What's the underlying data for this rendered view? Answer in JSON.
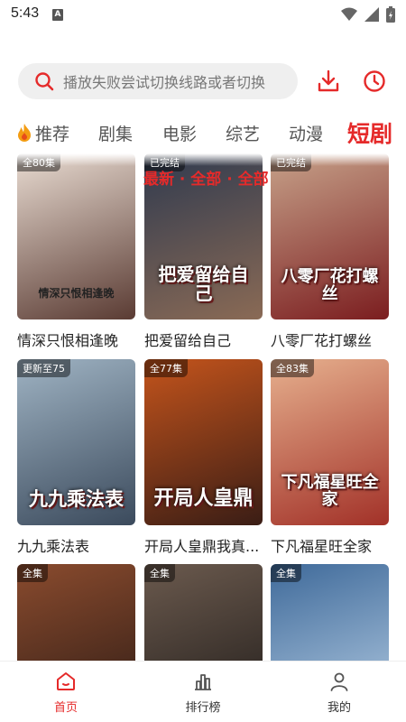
{
  "status_bar": {
    "time": "5:43",
    "notification_letter": "A"
  },
  "search": {
    "placeholder": "播放失败尝试切换线路或者切换"
  },
  "tabs": [
    {
      "label": "推荐"
    },
    {
      "label": "剧集"
    },
    {
      "label": "电影"
    },
    {
      "label": "综艺"
    },
    {
      "label": "动漫"
    },
    {
      "label": "短剧",
      "active": true
    }
  ],
  "filter_label": "最新 · 全部 · 全部",
  "cards": [
    {
      "badge": "全80集",
      "title": "情深只恨相逢晚",
      "poster_text": "情深只恨相逢晚",
      "colors": [
        "#e9dcd2",
        "#5a3b33"
      ]
    },
    {
      "badge": "已完结",
      "title": "把爱留给自己",
      "poster_text": "把爱留给自己",
      "colors": [
        "#2f3a4f",
        "#8a6a55"
      ]
    },
    {
      "badge": "已完结",
      "title": "八零厂花打螺丝",
      "poster_text": "八零厂花打螺丝",
      "colors": [
        "#c7a28a",
        "#7b1d1f"
      ]
    },
    {
      "badge": "更新至75",
      "title": "九九乘法表",
      "poster_text": "九九乘法表",
      "colors": [
        "#9fb3c3",
        "#3b4a5c"
      ]
    },
    {
      "badge": "全77集",
      "title": "开局人皇鼎我真...",
      "poster_text": "开局人皇鼎",
      "colors": [
        "#c4541c",
        "#3a1d15"
      ]
    },
    {
      "badge": "全83集",
      "title": "下凡福星旺全家",
      "poster_text": "下凡福星旺全家",
      "colors": [
        "#e6b08e",
        "#a23128"
      ]
    },
    {
      "badge": "全集",
      "title": "",
      "poster_text": "",
      "colors": [
        "#8a4b2e",
        "#2b1a14"
      ]
    },
    {
      "badge": "全集",
      "title": "",
      "poster_text": "",
      "colors": [
        "#6b5a4e",
        "#1e1a18"
      ]
    },
    {
      "badge": "全集",
      "title": "",
      "poster_text": "",
      "colors": [
        "#3f6a9a",
        "#b9d0e6"
      ]
    }
  ],
  "bottom_nav": [
    {
      "label": "首页",
      "icon": "home-icon",
      "active": true
    },
    {
      "label": "排行榜",
      "icon": "chart-icon"
    },
    {
      "label": "我的",
      "icon": "user-icon"
    }
  ],
  "accent_color": "#e52a2a"
}
